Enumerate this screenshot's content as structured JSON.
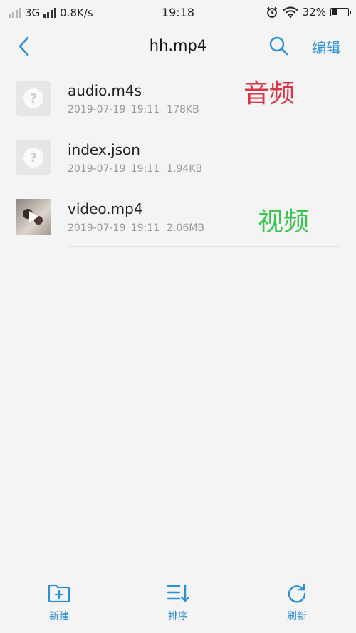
{
  "status_bar": {
    "network": "3G",
    "speed": "0.8K/s",
    "time": "19:18",
    "battery": "32%"
  },
  "nav": {
    "title": "hh.mp4",
    "edit_label": "编辑",
    "accent_color": "#2a8fd6"
  },
  "files": [
    {
      "name": "audio.m4s",
      "date": "2019-07-19 19:11",
      "size": "178KB",
      "icon": "unknown-file-icon"
    },
    {
      "name": "index.json",
      "date": "2019-07-19 19:11",
      "size": "1.94KB",
      "icon": "unknown-file-icon"
    },
    {
      "name": "video.mp4",
      "date": "2019-07-19 19:11",
      "size": "2.06MB",
      "icon": "video-thumbnail"
    }
  ],
  "annotations": {
    "audio": "音频",
    "video": "视频",
    "audio_color": "#d93545",
    "video_color": "#38c44f"
  },
  "toolbar": {
    "new_label": "新建",
    "sort_label": "排序",
    "refresh_label": "刷新"
  }
}
